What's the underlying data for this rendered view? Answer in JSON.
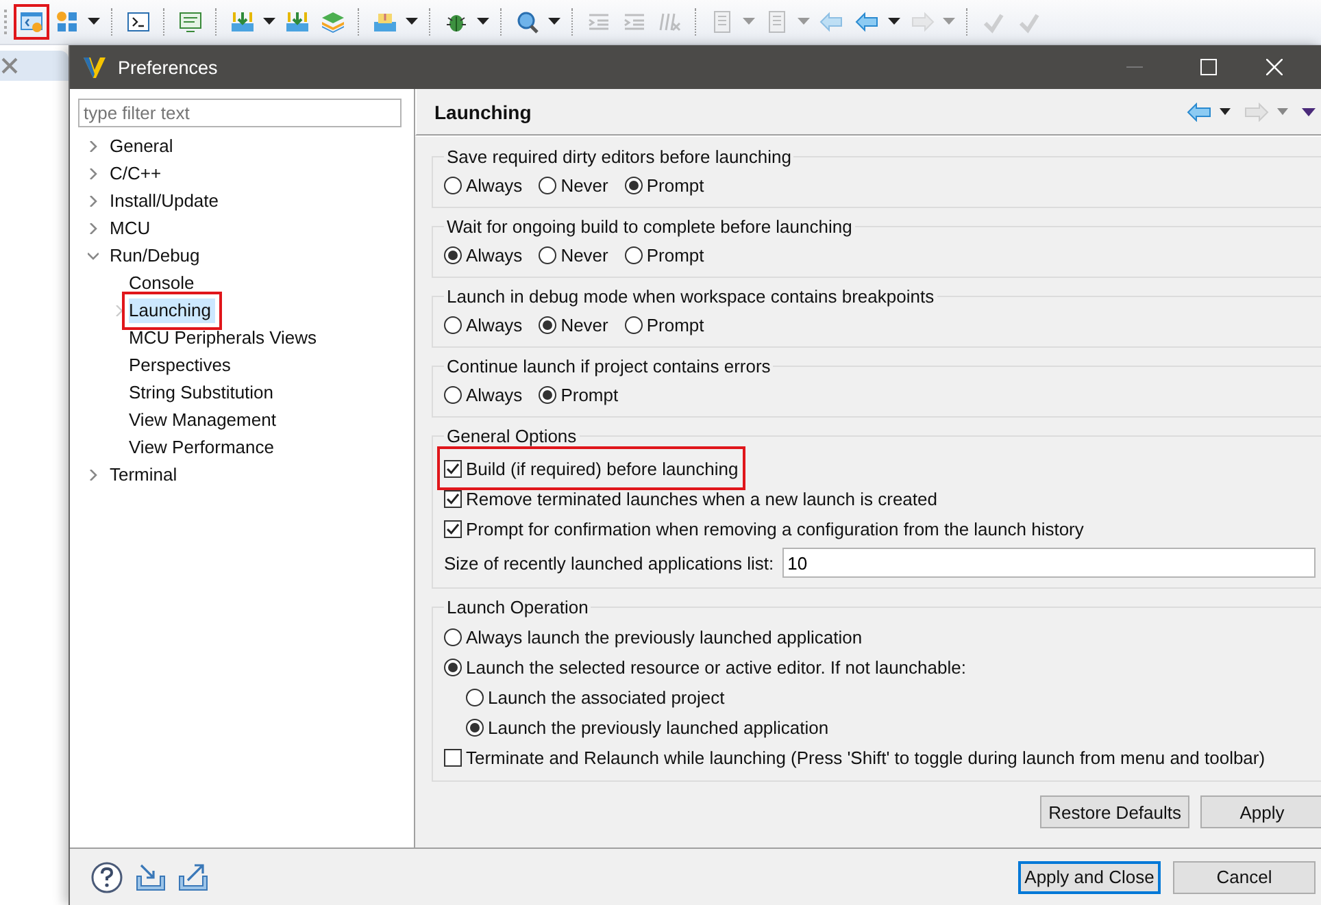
{
  "toolbar": [
    {
      "kind": "app",
      "highlighted": true,
      "disabled": false
    },
    {
      "kind": "modules",
      "highlighted": false,
      "disabled": false
    },
    {
      "kind": "dropdown",
      "disabled": false
    },
    {
      "kind": "separator"
    },
    {
      "kind": "terminal",
      "highlighted": false,
      "disabled": false
    },
    {
      "kind": "separator"
    },
    {
      "kind": "monitor",
      "highlighted": false,
      "disabled": false
    },
    {
      "kind": "separator"
    },
    {
      "kind": "download",
      "highlighted": false,
      "disabled": false
    },
    {
      "kind": "dropdown",
      "disabled": false
    },
    {
      "kind": "download",
      "highlighted": false,
      "disabled": false
    },
    {
      "kind": "layers",
      "highlighted": false,
      "disabled": false
    },
    {
      "kind": "separator"
    },
    {
      "kind": "tray",
      "highlighted": false,
      "disabled": false
    },
    {
      "kind": "dropdown",
      "disabled": false
    },
    {
      "kind": "separator"
    },
    {
      "kind": "bug",
      "highlighted": false,
      "disabled": false
    },
    {
      "kind": "dropdown",
      "disabled": false
    },
    {
      "kind": "separator"
    },
    {
      "kind": "search",
      "highlighted": false,
      "disabled": false
    },
    {
      "kind": "dropdown",
      "disabled": false
    },
    {
      "kind": "separator"
    },
    {
      "kind": "indent",
      "highlighted": false,
      "disabled": true
    },
    {
      "kind": "indent",
      "highlighted": false,
      "disabled": true
    },
    {
      "kind": "clear",
      "highlighted": false,
      "disabled": true
    },
    {
      "kind": "separator"
    },
    {
      "kind": "document",
      "highlighted": false,
      "disabled": true
    },
    {
      "kind": "dropdown",
      "disabled": true
    },
    {
      "kind": "document",
      "highlighted": false,
      "disabled": true
    },
    {
      "kind": "dropdown",
      "disabled": true
    },
    {
      "kind": "back",
      "highlighted": false,
      "disabled": true
    },
    {
      "kind": "back",
      "highlighted": false,
      "disabled": false
    },
    {
      "kind": "dropdown",
      "disabled": false
    },
    {
      "kind": "forward",
      "highlighted": false,
      "disabled": true
    },
    {
      "kind": "dropdown",
      "disabled": true
    },
    {
      "kind": "separator"
    },
    {
      "kind": "undo",
      "highlighted": false,
      "disabled": true
    },
    {
      "kind": "undo",
      "highlighted": false,
      "disabled": true
    }
  ],
  "dialog": {
    "title": "Preferences"
  },
  "filter": {
    "placeholder": "type filter text"
  },
  "tree": [
    {
      "label": "General",
      "expanded": false,
      "selected": false,
      "highlighted": false
    },
    {
      "label": "C/C++",
      "expanded": false,
      "selected": false,
      "highlighted": false
    },
    {
      "label": "Install/Update",
      "expanded": false,
      "selected": false,
      "highlighted": false
    },
    {
      "label": "MCU",
      "expanded": false,
      "selected": false,
      "highlighted": false
    },
    {
      "label": "Run/Debug",
      "expanded": true,
      "selected": false,
      "highlighted": false,
      "children": [
        {
          "label": "Console",
          "selected": false,
          "highlighted": false
        },
        {
          "label": "Launching",
          "expanded": false,
          "selected": true,
          "highlighted": true
        },
        {
          "label": "MCU Peripherals Views",
          "selected": false,
          "highlighted": false
        },
        {
          "label": "Perspectives",
          "selected": false,
          "highlighted": false
        },
        {
          "label": "String Substitution",
          "selected": false,
          "highlighted": false
        },
        {
          "label": "View Management",
          "selected": false,
          "highlighted": false
        },
        {
          "label": "View Performance",
          "selected": false,
          "highlighted": false
        }
      ]
    },
    {
      "label": "Terminal",
      "expanded": false,
      "selected": false,
      "highlighted": false
    }
  ],
  "page": {
    "title": "Launching",
    "back_enabled": true,
    "forward_enabled": false
  },
  "radio_groups": [
    {
      "title": "Save required dirty editors before launching",
      "options": [
        {
          "label": "Always",
          "selected": false
        },
        {
          "label": "Never",
          "selected": false
        },
        {
          "label": "Prompt",
          "selected": true
        }
      ]
    },
    {
      "title": "Wait for ongoing build to complete before launching",
      "options": [
        {
          "label": "Always",
          "selected": true
        },
        {
          "label": "Never",
          "selected": false
        },
        {
          "label": "Prompt",
          "selected": false
        }
      ]
    },
    {
      "title": "Launch in debug mode when workspace contains breakpoints",
      "options": [
        {
          "label": "Always",
          "selected": false
        },
        {
          "label": "Never",
          "selected": true
        },
        {
          "label": "Prompt",
          "selected": false
        }
      ]
    },
    {
      "title": "Continue launch if project contains errors",
      "options": [
        {
          "label": "Always",
          "selected": false
        },
        {
          "label": "Prompt",
          "selected": true
        }
      ]
    }
  ],
  "general_options": {
    "title": "General Options",
    "checkboxes": [
      {
        "label": "Build (if required) before launching",
        "checked": true,
        "highlighted": true
      },
      {
        "label": "Remove terminated launches when a new launch is created",
        "checked": true,
        "highlighted": false
      },
      {
        "label": "Prompt for confirmation when removing a configuration from the launch history",
        "checked": true,
        "highlighted": false
      }
    ],
    "field": {
      "label": "Size of recently launched applications list:",
      "value": "10"
    }
  },
  "launch_operation": {
    "title": "Launch Operation",
    "items": [
      {
        "kind": "radio",
        "label": "Always launch the previously launched application",
        "selected": false
      },
      {
        "kind": "radio",
        "label": "Launch the selected resource or active editor. If not launchable:",
        "selected": true,
        "children": [
          {
            "kind": "radio",
            "label": "Launch the associated project",
            "selected": false
          },
          {
            "kind": "radio",
            "label": "Launch the previously launched application",
            "selected": true
          }
        ]
      },
      {
        "kind": "checkbox",
        "label": "Terminate and Relaunch while launching (Press 'Shift' to toggle during launch from menu and toolbar)",
        "checked": false
      }
    ]
  },
  "page_buttons": [
    {
      "label": "Restore Defaults",
      "default": false
    },
    {
      "label": "Apply",
      "default": false
    }
  ],
  "dialog_buttons": [
    {
      "label": "Apply and Close",
      "default": true
    },
    {
      "label": "Cancel",
      "default": false
    }
  ]
}
